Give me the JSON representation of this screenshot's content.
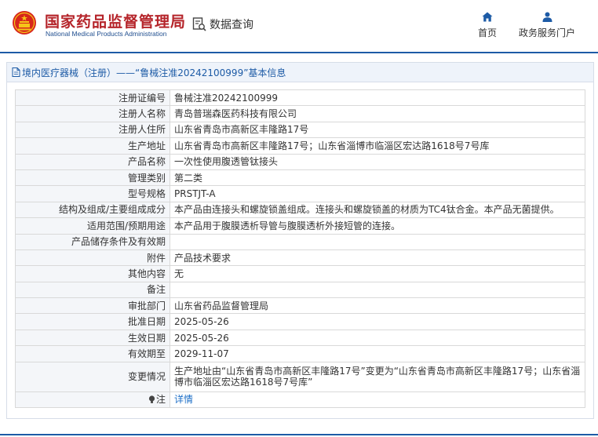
{
  "header": {
    "site_name": "国家药品监督管理局",
    "site_sub": "National Medical Products Administration",
    "query_label": "数据查询",
    "nav": [
      {
        "label": "首页",
        "icon": "home-icon"
      },
      {
        "label": "政务服务门户",
        "icon": "user-icon"
      }
    ]
  },
  "colors": {
    "brand_red": "#b5242a",
    "brand_blue": "#1d5ba6",
    "link": "#1d6fc7"
  },
  "panel": {
    "title": "境内医疗器械（注册）——“鲁械注准20242100999”基本信息"
  },
  "rows": [
    {
      "label": "注册证编号",
      "value": "鲁械注准20242100999"
    },
    {
      "label": "注册人名称",
      "value": "青岛普瑞森医药科技有限公司"
    },
    {
      "label": "注册人住所",
      "value": "山东省青岛市高新区丰隆路17号"
    },
    {
      "label": "生产地址",
      "value": "山东省青岛市高新区丰隆路17号；山东省淄博市临淄区宏达路1618号7号库"
    },
    {
      "label": "产品名称",
      "value": "一次性使用腹透管钛接头"
    },
    {
      "label": "管理类别",
      "value": "第二类"
    },
    {
      "label": "型号规格",
      "value": "PRSTJT-A"
    },
    {
      "label": "结构及组成/主要组成成分",
      "value": "本产品由连接头和螺旋锁盖组成。连接头和螺旋锁盖的材质为TC4钛合金。本产品无菌提供。"
    },
    {
      "label": "适用范围/预期用途",
      "value": "本产品用于腹膜透析导管与腹膜透析外接短管的连接。"
    },
    {
      "label": "产品储存条件及有效期",
      "value": ""
    },
    {
      "label": "附件",
      "value": "产品技术要求"
    },
    {
      "label": "其他内容",
      "value": "无"
    },
    {
      "label": "备注",
      "value": ""
    },
    {
      "label": "审批部门",
      "value": "山东省药品监督管理局"
    },
    {
      "label": "批准日期",
      "value": "2025-05-26"
    },
    {
      "label": "生效日期",
      "value": "2025-05-26"
    },
    {
      "label": "有效期至",
      "value": "2029-11-07"
    },
    {
      "label": "变更情况",
      "value": "生产地址由“山东省青岛市高新区丰隆路17号”变更为“山东省青岛市高新区丰隆路17号；山东省淄博市临淄区宏达路1618号7号库”"
    },
    {
      "label": "注",
      "value": "详情"
    }
  ]
}
